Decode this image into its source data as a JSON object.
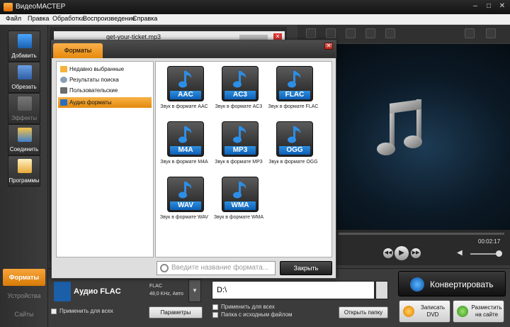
{
  "window": {
    "title": "ВидеоМАСТЕР"
  },
  "menu": [
    "Файл",
    "Правка",
    "Обработка",
    "Воспроизведение",
    "Справка"
  ],
  "sidebar": [
    {
      "label": "Добавить",
      "icon": "add-film-icon",
      "enabled": true
    },
    {
      "label": "Обрезать",
      "icon": "scissors-film-icon",
      "enabled": true
    },
    {
      "label": "Эффекты",
      "icon": "effects-icon",
      "enabled": false
    },
    {
      "label": "Соединить",
      "icon": "join-icon",
      "enabled": true
    },
    {
      "label": "Программы",
      "icon": "programs-icon",
      "enabled": true
    }
  ],
  "left_tabs": [
    {
      "label": "Форматы",
      "active": true
    },
    {
      "label": "Устройства",
      "active": false
    },
    {
      "label": "Сайты",
      "active": false
    }
  ],
  "file": {
    "name": "get-your-ticket.mp3"
  },
  "dialog": {
    "tab": "Форматы",
    "categories": [
      {
        "label": "Недавно выбранные",
        "active": false
      },
      {
        "label": "Результаты поиска",
        "active": false
      },
      {
        "label": "Пользовательские",
        "active": false
      },
      {
        "label": "Аудио форматы",
        "active": true
      }
    ],
    "formats": [
      {
        "badge": "AAC",
        "caption": "Звук в формате AAC"
      },
      {
        "badge": "AC3",
        "caption": "Звук в формате AC3"
      },
      {
        "badge": "FLAC",
        "caption": "Звук в формате FLAC"
      },
      {
        "badge": "M4A",
        "caption": "Звук в формате M4A"
      },
      {
        "badge": "MP3",
        "caption": "Звук в формате MP3"
      },
      {
        "badge": "OGG",
        "caption": "Звук в формате OGG"
      },
      {
        "badge": "WAV",
        "caption": "Звук в формате WAV"
      },
      {
        "badge": "WMA",
        "caption": "Звук в формате WMA"
      }
    ],
    "search_placeholder": "Введите название формата...",
    "close_label": "Закрыть"
  },
  "player": {
    "time": "00:02:17"
  },
  "output": {
    "format_name": "Аудио FLAC",
    "format_info_1": "FLAC",
    "format_info_2": "48,0 KHz, Авто",
    "apply_all": "Применить для всех",
    "params_label": "Параметры",
    "path": "D:\\",
    "apply_all_2": "Применить для всех",
    "same_folder": "Папка с исходным файлом",
    "open_folder": "Открыть папку",
    "convert": "Конвертировать",
    "burn_dvd": "Записать DVD",
    "publish": "Разместить на сайте"
  },
  "colors": {
    "accent": "#f19a1f",
    "badge": "#1a73c8",
    "dark": "#2f2f2f"
  }
}
